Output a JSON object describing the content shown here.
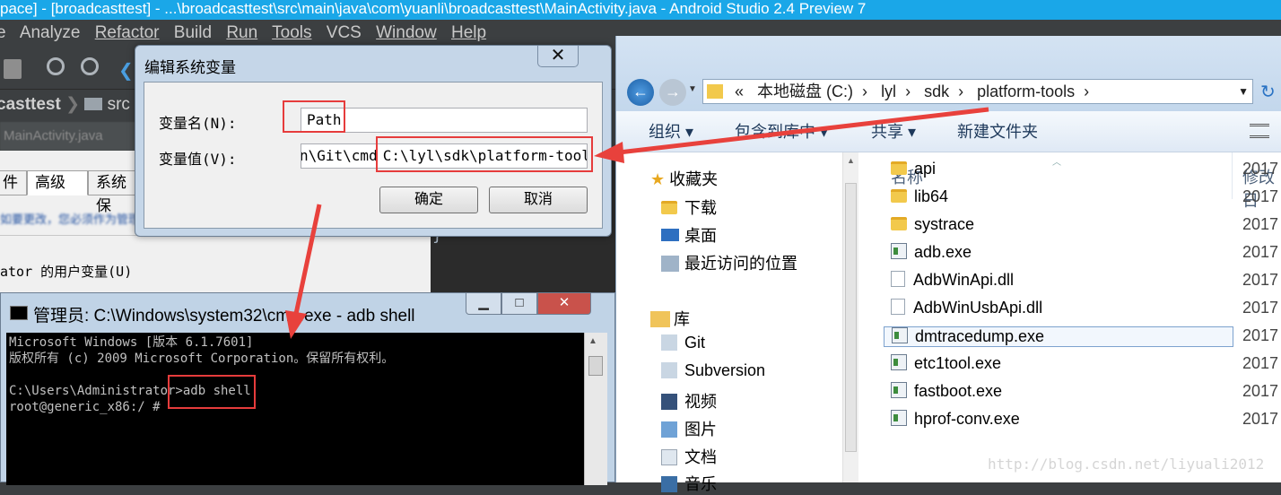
{
  "android_studio": {
    "title": "pace] - [broadcasttest] - ...\\broadcasttest\\src\\main\\java\\com\\yuanli\\broadcasttest\\MainActivity.java - Android Studio 2.4 Preview 7",
    "menu": [
      "e",
      "Analyze",
      "Refactor",
      "Build",
      "Run",
      "Tools",
      "VCS",
      "Window",
      "Help"
    ],
    "nav_project": "casttest",
    "nav_src": "src",
    "toolbar_hint": "broadcasttest",
    "editor_tab": "MainActivity.java"
  },
  "sys_props": {
    "tabs": [
      "件",
      "高级",
      "系统保"
    ],
    "hint": "如要更改，您必须作为管理员登录",
    "user_vars_label": "ator 的用户变量(U)"
  },
  "edit_dialog": {
    "title": "编辑系统变量",
    "close": "✕",
    "var_name_label": "变量名(N):",
    "var_name_value": "Path",
    "var_value_label": "变量值(V):",
    "var_value_prefix": "n\\Git\\cmd",
    "var_value_highlight": "C:\\lyl\\sdk\\platform-tools",
    "ok": "确定",
    "cancel": "取消"
  },
  "cmd": {
    "title": "管理员: C:\\Windows\\system32\\cmd.exe - adb  shell",
    "lines": [
      "Microsoft Windows [版本 6.1.7601]",
      "版权所有 (c) 2009 Microsoft Corporation。保留所有权利。",
      "",
      "C:\\Users\\Administrator>adb shell",
      "root@generic_x86:/ #"
    ],
    "min": "▁",
    "max": "□",
    "close": "✕"
  },
  "explorer": {
    "breadcrumb": [
      "«",
      "本地磁盘 (C:)",
      "lyl",
      "sdk",
      "platform-tools"
    ],
    "cmdbar": [
      "组织 ▾",
      "包含到库中 ▾",
      "共享 ▾",
      "新建文件夹"
    ],
    "nav": {
      "favorites": "收藏夹",
      "downloads": "下载",
      "desktop": "桌面",
      "recent": "最近访问的位置",
      "libraries": "库",
      "git": "Git",
      "svn": "Subversion",
      "video": "视频",
      "pictures": "图片",
      "docs": "文档",
      "music": "音乐"
    },
    "col_name": "名称",
    "col_date": "修改日",
    "files": [
      {
        "name": "api",
        "type": "folder",
        "date": "2017"
      },
      {
        "name": "lib64",
        "type": "folder",
        "date": "2017"
      },
      {
        "name": "systrace",
        "type": "folder",
        "date": "2017"
      },
      {
        "name": "adb.exe",
        "type": "exe",
        "date": "2017"
      },
      {
        "name": "AdbWinApi.dll",
        "type": "dll",
        "date": "2017"
      },
      {
        "name": "AdbWinUsbApi.dll",
        "type": "dll",
        "date": "2017"
      },
      {
        "name": "dmtracedump.exe",
        "type": "exe",
        "date": "2017"
      },
      {
        "name": "etc1tool.exe",
        "type": "exe",
        "date": "2017"
      },
      {
        "name": "fastboot.exe",
        "type": "exe",
        "date": "2017"
      },
      {
        "name": "hprof-conv.exe",
        "type": "exe",
        "date": "2017"
      }
    ],
    "watermark": "http://blog.csdn.net/liyuali2012"
  },
  "colors": {
    "highlight_red": "#e63c3c",
    "as_title_bg": "#1aa7e8"
  }
}
